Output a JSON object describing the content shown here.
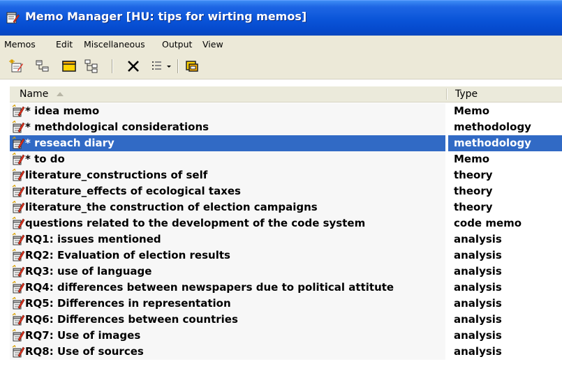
{
  "window": {
    "title": "Memo Manager [HU: tips for wirting memos]"
  },
  "menu": [
    "Memos",
    "Edit",
    "Miscellaneous",
    "Output",
    "View"
  ],
  "toolbar": [
    "new-memo-icon",
    "memo-tree-icon",
    "folder-icon",
    "code-tree-icon",
    "delete-icon",
    "list-options-icon",
    "dropdown-arrow-icon",
    "export-icon"
  ],
  "columns": {
    "name": "Name",
    "type": "Type"
  },
  "rows": [
    {
      "name": "* idea memo",
      "type": "Memo",
      "selected": false
    },
    {
      "name": "* methdological considerations",
      "type": "methodology",
      "selected": false
    },
    {
      "name": "* reseach diary",
      "type": "methodology",
      "selected": true
    },
    {
      "name": "* to do",
      "type": "Memo",
      "selected": false
    },
    {
      "name": "literature_constructions of self",
      "type": "theory",
      "selected": false
    },
    {
      "name": "literature_effects of ecological taxes",
      "type": "theory",
      "selected": false
    },
    {
      "name": "literature_the construction of election campaigns",
      "type": "theory",
      "selected": false
    },
    {
      "name": "questions related to the development of the code system",
      "type": "code memo",
      "selected": false
    },
    {
      "name": "RQ1: issues mentioned",
      "type": "analysis",
      "selected": false
    },
    {
      "name": "RQ2: Evaluation of election results",
      "type": "analysis",
      "selected": false
    },
    {
      "name": "RQ3: use of language",
      "type": "analysis",
      "selected": false
    },
    {
      "name": "RQ4: differences between newspapers due to political attitute",
      "type": "analysis",
      "selected": false
    },
    {
      "name": "RQ5: Differences in representation",
      "type": "analysis",
      "selected": false
    },
    {
      "name": "RQ6: Differences between countries",
      "type": "analysis",
      "selected": false
    },
    {
      "name": "RQ7: Use of images",
      "type": "analysis",
      "selected": false
    },
    {
      "name": "RQ8: Use of sources",
      "type": "analysis",
      "selected": false
    }
  ],
  "colors": {
    "titlebar": "#0a54d8",
    "selection": "#316ac5",
    "chrome": "#ece9d8"
  }
}
